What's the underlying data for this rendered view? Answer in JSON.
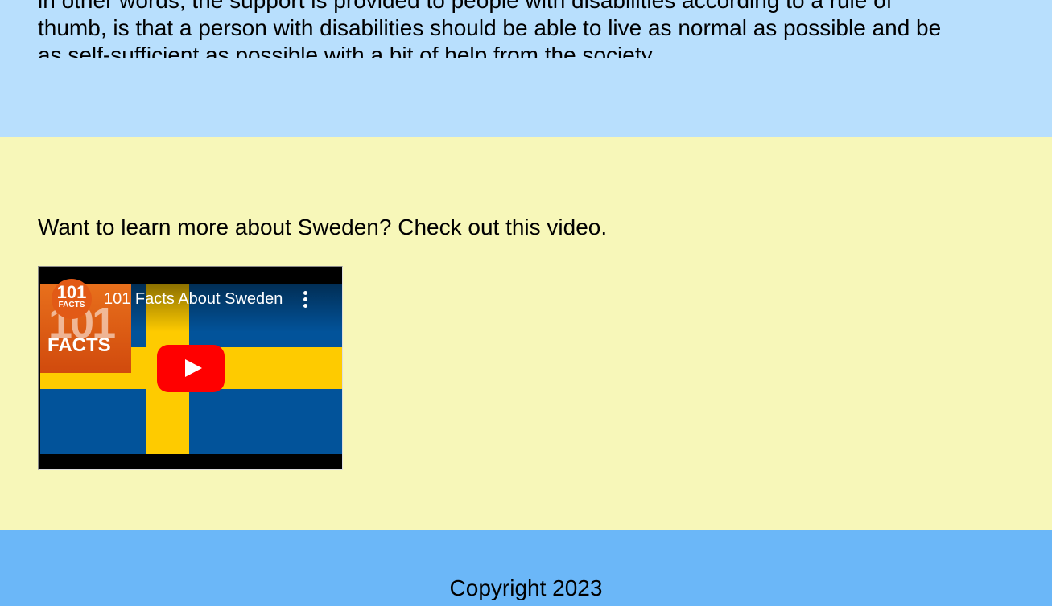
{
  "intro": {
    "line1": "in other words, the support is provided to people with disabilities according to a rule of",
    "line2": "thumb, is that a person with disabilities should be able to live as normal as possible and be",
    "line3": "as self-sufficient as possible with a bit of help from the society."
  },
  "video_section": {
    "prompt": "Want to learn more about Sweden? Check out this video.",
    "video": {
      "title": "101 Facts About Sweden",
      "channel_number": "101",
      "channel_label": "FACTS",
      "thumbnail_number": "101",
      "thumbnail_label": "FACTS",
      "colors": {
        "flag_blue": "#02539a",
        "flag_yellow": "#fecb00",
        "play_red": "#ff0000",
        "brand_orange": "#e25a16"
      }
    }
  },
  "footer": {
    "copyright": "Copyright 2023"
  },
  "colors": {
    "top_background": "#b8dffd",
    "middle_background": "#f7f7b9",
    "footer_background": "#6bb7f8"
  }
}
